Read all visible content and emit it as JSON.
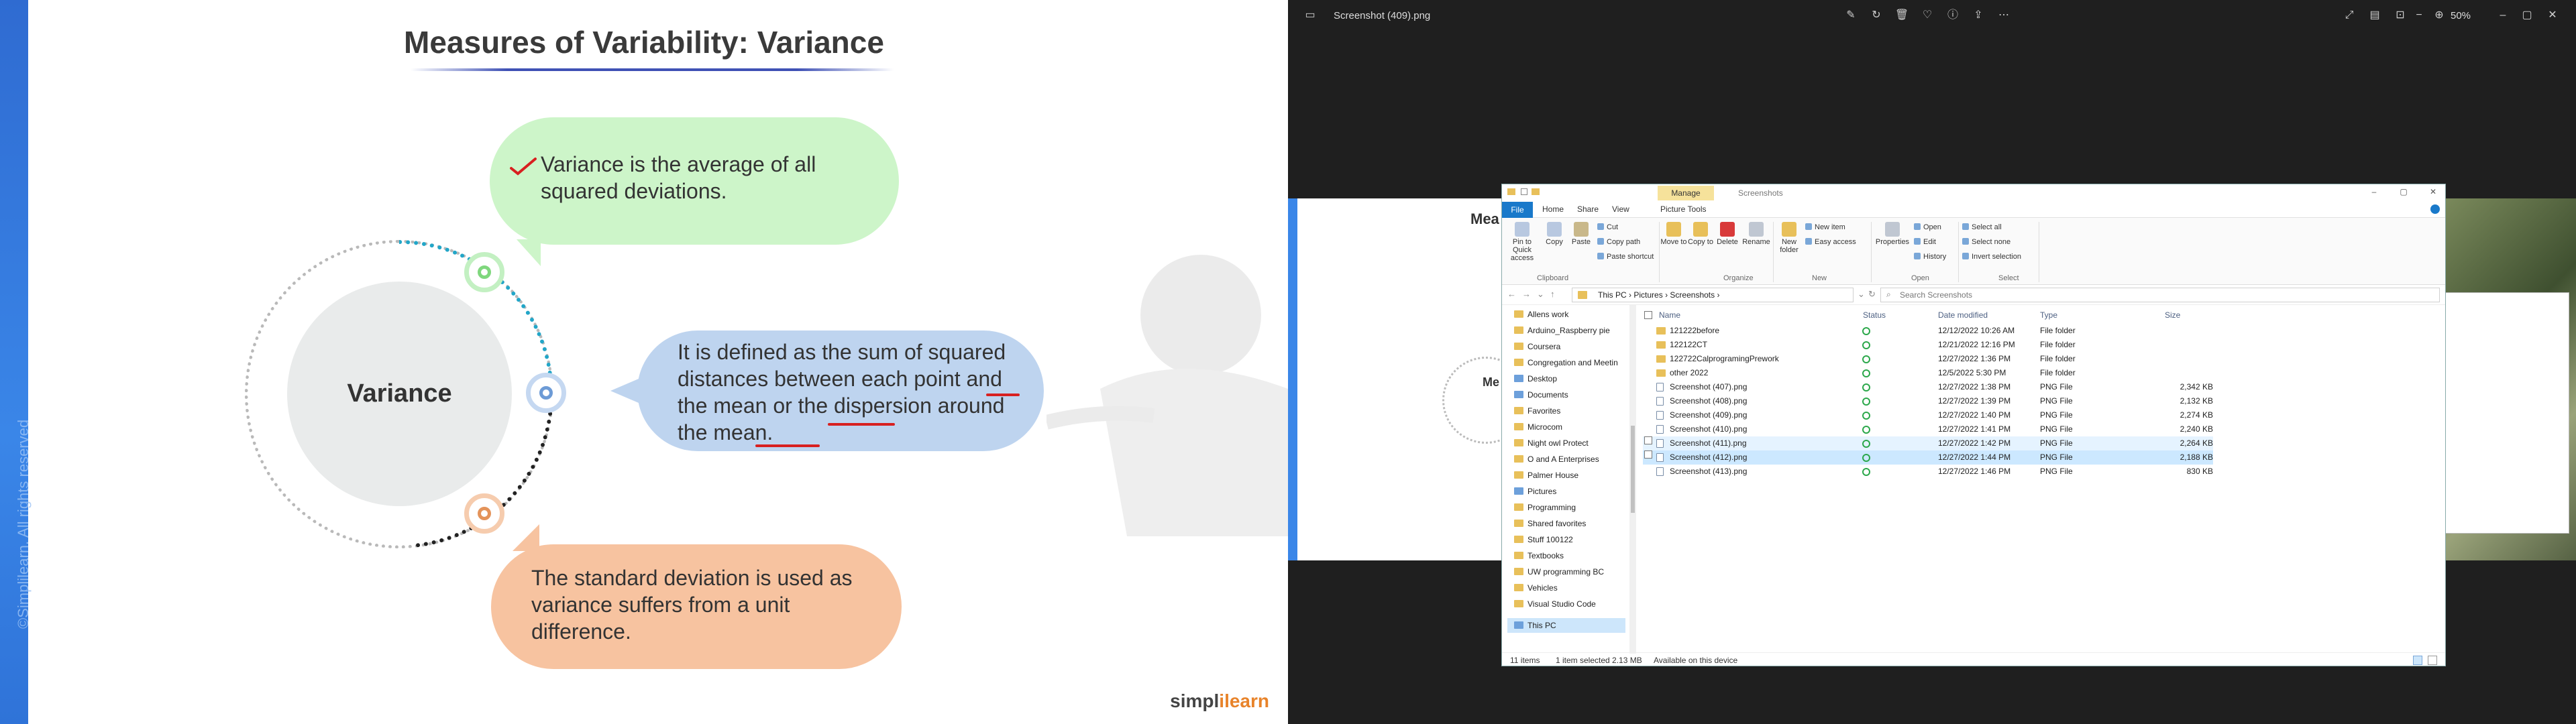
{
  "slide": {
    "title": "Measures of Variability: Variance",
    "center_label": "Variance",
    "bubble1": "Variance is the average of all squared deviations.",
    "bubble2": "It is defined as the sum of squared distances between each point and the mean or the dispersion around the mean.",
    "bubble3": "The standard deviation is used as variance suffers from a unit difference.",
    "copyright": "©Simplilearn. All rights reserved",
    "brand_a": "simpl",
    "brand_b": "ilearn"
  },
  "viewer": {
    "file_name": "Screenshot (409).png",
    "zoom": "50%",
    "photo_title": "Mea",
    "photo_center": "Me"
  },
  "explorer": {
    "manage_tab": "Manage",
    "window_title": "Screenshots",
    "tabs": [
      "File",
      "Home",
      "Share",
      "View",
      "Picture Tools"
    ],
    "ribbon": {
      "pin": "Pin to Quick access",
      "copy": "Copy",
      "paste": "Paste",
      "cut": "Cut",
      "copy_path": "Copy path",
      "paste_shortcut": "Paste shortcut",
      "move_to": "Move to",
      "copy_to": "Copy to",
      "delete": "Delete",
      "rename": "Rename",
      "new_folder": "New folder",
      "new_item": "New item",
      "easy_access": "Easy access",
      "properties": "Properties",
      "open": "Open",
      "edit": "Edit",
      "history": "History",
      "select_all": "Select all",
      "select_none": "Select none",
      "invert_selection": "Invert selection",
      "groups": [
        "Clipboard",
        "Organize",
        "New",
        "Open",
        "Select"
      ]
    },
    "address": [
      "This PC",
      "Pictures",
      "Screenshots"
    ],
    "search_placeholder": "Search Screenshots",
    "nav": [
      "Allens work",
      "Arduino_Raspberry pie",
      "Coursera",
      "Congregation and Meetin",
      "Desktop",
      "Documents",
      "Favorites",
      "Microcom",
      "Night owl Protect",
      "O and A Enterprises",
      "Palmer House",
      "Pictures",
      "Programming",
      "Shared favorites",
      "Stuff 100122",
      "Textbooks",
      "UW programming BC",
      "Vehicles",
      "Visual Studio Code",
      "This PC"
    ],
    "columns": [
      "Name",
      "Status",
      "Date modified",
      "Type",
      "Size"
    ],
    "rows": [
      {
        "name": "121222before",
        "date": "12/12/2022 10:26 AM",
        "type": "File folder",
        "size": ""
      },
      {
        "name": "122122CT",
        "date": "12/21/2022 12:16 PM",
        "type": "File folder",
        "size": ""
      },
      {
        "name": "122722CalprogramingPrework",
        "date": "12/27/2022 1:36 PM",
        "type": "File folder",
        "size": ""
      },
      {
        "name": "other 2022",
        "date": "12/5/2022 5:30 PM",
        "type": "File folder",
        "size": ""
      },
      {
        "name": "Screenshot (407).png",
        "date": "12/27/2022 1:38 PM",
        "type": "PNG File",
        "size": "2,342 KB"
      },
      {
        "name": "Screenshot (408).png",
        "date": "12/27/2022 1:39 PM",
        "type": "PNG File",
        "size": "2,132 KB"
      },
      {
        "name": "Screenshot (409).png",
        "date": "12/27/2022 1:40 PM",
        "type": "PNG File",
        "size": "2,274 KB"
      },
      {
        "name": "Screenshot (410).png",
        "date": "12/27/2022 1:41 PM",
        "type": "PNG File",
        "size": "2,240 KB"
      },
      {
        "name": "Screenshot (411).png",
        "date": "12/27/2022 1:42 PM",
        "type": "PNG File",
        "size": "2,264 KB"
      },
      {
        "name": "Screenshot (412).png",
        "date": "12/27/2022 1:44 PM",
        "type": "PNG File",
        "size": "2,188 KB"
      },
      {
        "name": "Screenshot (413).png",
        "date": "12/27/2022 1:46 PM",
        "type": "PNG File",
        "size": "830 KB"
      }
    ],
    "status_items": "11 items",
    "status_selected": "1 item selected 2.13 MB",
    "status_available": "Available on this device"
  }
}
